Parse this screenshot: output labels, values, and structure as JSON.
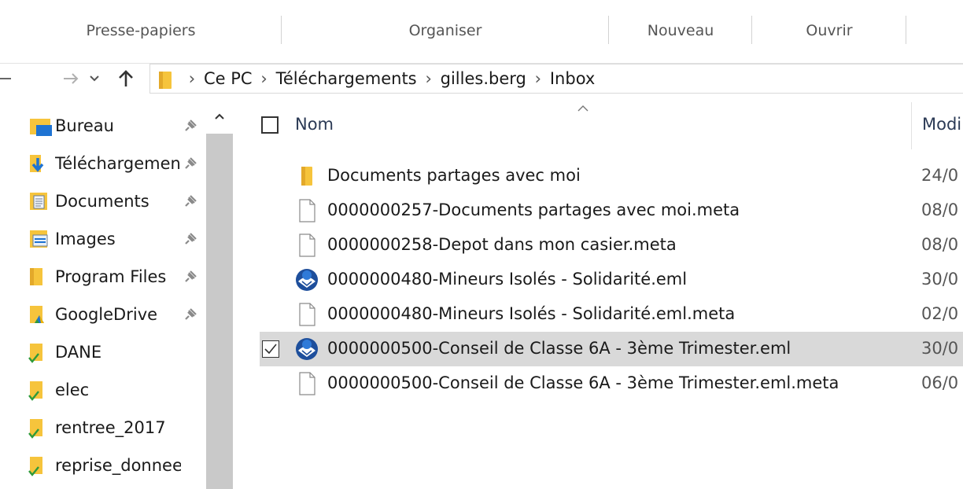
{
  "ribbon": {
    "groups": [
      "Presse-papiers",
      "Organiser",
      "Nouveau",
      "Ouvrir"
    ]
  },
  "nav": {
    "back_icon": "back-arrow-icon",
    "forward_icon": "forward-arrow-icon",
    "recent_icon": "chevron-down-icon",
    "up_icon": "up-arrow-icon"
  },
  "address": {
    "crumbs": [
      "Ce PC",
      "Téléchargements",
      "gilles.berg",
      "Inbox"
    ]
  },
  "sidebar": {
    "items": [
      {
        "label": "Bureau",
        "icon": "desktop-folder-icon",
        "pinned": true
      },
      {
        "label": "Téléchargements",
        "icon": "downloads-folder-icon",
        "pinned": true
      },
      {
        "label": "Documents",
        "icon": "documents-folder-icon",
        "pinned": true
      },
      {
        "label": "Images",
        "icon": "pictures-folder-icon",
        "pinned": true
      },
      {
        "label": "Program Files",
        "icon": "folder-icon",
        "pinned": true
      },
      {
        "label": "GoogleDrive",
        "icon": "google-drive-folder-icon",
        "pinned": true
      },
      {
        "label": "DANE",
        "icon": "synced-folder-icon",
        "pinned": false
      },
      {
        "label": "elec",
        "icon": "synced-folder-icon",
        "pinned": false
      },
      {
        "label": "rentree_2017",
        "icon": "synced-folder-icon",
        "pinned": false
      },
      {
        "label": "reprise_donnee",
        "icon": "synced-folder-icon",
        "pinned": false
      }
    ]
  },
  "columns": {
    "name": "Nom",
    "modified": "Modi"
  },
  "files": [
    {
      "name": "Documents partages avec moi",
      "date": "24/0",
      "type": "folder",
      "selected": false
    },
    {
      "name": "0000000257-Documents partages avec moi.meta",
      "date": "08/0",
      "type": "file",
      "selected": false
    },
    {
      "name": "0000000258-Depot dans mon casier.meta",
      "date": "08/0",
      "type": "file",
      "selected": false
    },
    {
      "name": "0000000480-Mineurs Isolés - Solidarité.eml",
      "date": "30/0",
      "type": "eml",
      "selected": false
    },
    {
      "name": "0000000480-Mineurs Isolés - Solidarité.eml.meta",
      "date": "02/0",
      "type": "file",
      "selected": false
    },
    {
      "name": "0000000500-Conseil de Classe 6A - 3ème Trimester.eml",
      "date": "30/0",
      "type": "eml",
      "selected": true
    },
    {
      "name": "0000000500-Conseil de Classe 6A - 3ème Trimester.eml.meta",
      "date": "06/0",
      "type": "file",
      "selected": false
    }
  ],
  "colors": {
    "folder": "#f6c43c",
    "selection": "#d9d9d9",
    "accent_blue": "#1e73d2",
    "sync_green": "#2e9a3c"
  }
}
